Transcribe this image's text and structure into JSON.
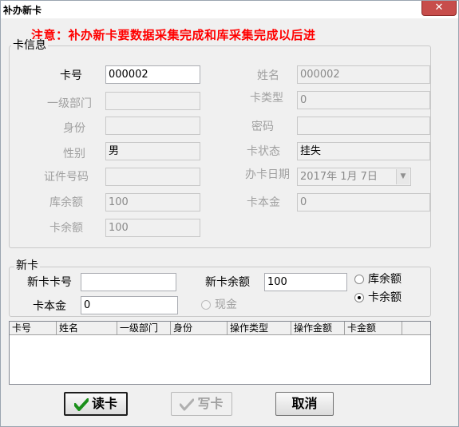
{
  "window": {
    "title": "补办新卡",
    "close_glyph": "✕"
  },
  "notice": "注意：补办新卡要数据采集完成和库采集完成以后进",
  "card_info": {
    "legend": "卡信息",
    "card_no_label": "卡号",
    "card_no_value": "000002",
    "name_label": "姓名",
    "name_value": "000002",
    "dept_label": "一级部门",
    "dept_value": "",
    "card_type_label": "卡类型",
    "card_type_value": "0",
    "identity_label": "身份",
    "identity_value": "",
    "password_label": "密码",
    "password_value": "",
    "gender_label": "性别",
    "gender_value": "男",
    "card_status_label": "卡状态",
    "card_status_value": "挂失",
    "id_no_label": "证件号码",
    "id_no_value": "",
    "issue_date_label": "办卡日期",
    "issue_date_value": "2017年 1月 7日",
    "lib_balance_label": "库余额",
    "lib_balance_value": "100",
    "card_deposit_label": "卡本金",
    "card_deposit_value": "0",
    "card_balance_label": "卡余额",
    "card_balance_value": "100"
  },
  "new_card": {
    "legend": "新卡",
    "new_card_no_label": "新卡卡号",
    "new_card_no_value": "",
    "new_balance_label": "新卡余额",
    "new_balance_value": "100",
    "deposit_label": "卡本金",
    "deposit_value": "0",
    "cash_label": "现金",
    "lib_balance_option": "库余额",
    "card_balance_option": "卡余额",
    "selected_option": "卡余额"
  },
  "table": {
    "columns": [
      "卡号",
      "姓名",
      "一级部门",
      "身份",
      "操作类型",
      "操作金额",
      "卡金额"
    ],
    "rows": []
  },
  "buttons": {
    "read_card": "读卡",
    "write_card": "写卡",
    "cancel": "取消"
  },
  "colors": {
    "notice": "#ff0000",
    "check_green": "#1a8f1a",
    "close_red": "#c74d4b"
  }
}
